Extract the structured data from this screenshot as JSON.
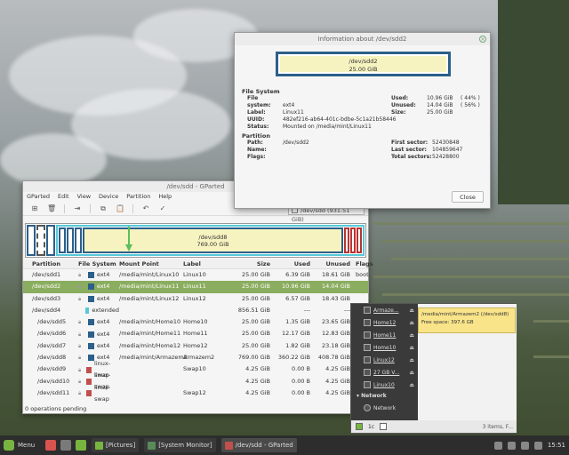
{
  "gparted": {
    "title": "/dev/sdd - GParted",
    "menu": [
      "GParted",
      "Edit",
      "View",
      "Device",
      "Partition",
      "Help"
    ],
    "device_selector": "/dev/sdd  (931.51 GiB)",
    "map_selected_label": "/dev/sdd8",
    "map_selected_size": "769.00 GiB",
    "columns": [
      "Partition",
      "File System",
      "Mount Point",
      "Label",
      "Size",
      "Used",
      "Unused",
      "Flags"
    ],
    "rows": [
      {
        "partition": "/dev/sdd1",
        "fs": "ext4",
        "fs_color": "#2c5f8a",
        "mount": "/media/mint/Linux10",
        "label": "Linux10",
        "size": "25.00 GiB",
        "used": "6.39 GiB",
        "unused": "18.61 GiB",
        "flags": "boot",
        "lock": true
      },
      {
        "partition": "/dev/sdd2",
        "fs": "ext4",
        "fs_color": "#2c5f8a",
        "mount": "/media/mint/Linux11",
        "label": "Linux11",
        "size": "25.00 GiB",
        "used": "10.96 GiB",
        "unused": "14.04 GiB",
        "flags": "",
        "lock": true,
        "selected": true
      },
      {
        "partition": "/dev/sdd3",
        "fs": "ext4",
        "fs_color": "#2c5f8a",
        "mount": "/media/mint/Linux12",
        "label": "Linux12",
        "size": "25.00 GiB",
        "used": "6.57 GiB",
        "unused": "18.43 GiB",
        "flags": "",
        "lock": true
      },
      {
        "partition": "/dev/sdd4",
        "fs": "extended",
        "fs_color": "#55c9d8",
        "mount": "",
        "label": "",
        "size": "856.51 GiB",
        "used": "---",
        "unused": "---",
        "flags": "",
        "lock": false
      },
      {
        "partition": "/dev/sdd5",
        "fs": "ext4",
        "fs_color": "#2c5f8a",
        "mount": "/media/mint/Home10",
        "label": "Home10",
        "size": "25.00 GiB",
        "used": "1.35 GiB",
        "unused": "23.65 GiB",
        "flags": "",
        "lock": true
      },
      {
        "partition": "/dev/sdd6",
        "fs": "ext4",
        "fs_color": "#2c5f8a",
        "mount": "/media/mint/Home11",
        "label": "Home11",
        "size": "25.00 GiB",
        "used": "12.17 GiB",
        "unused": "12.83 GiB",
        "flags": "",
        "lock": true
      },
      {
        "partition": "/dev/sdd7",
        "fs": "ext4",
        "fs_color": "#2c5f8a",
        "mount": "/media/mint/Home12",
        "label": "Home12",
        "size": "25.00 GiB",
        "used": "1.82 GiB",
        "unused": "23.18 GiB",
        "flags": "",
        "lock": true
      },
      {
        "partition": "/dev/sdd8",
        "fs": "ext4",
        "fs_color": "#2c5f8a",
        "mount": "/media/mint/Armazem2",
        "label": "Armazem2",
        "size": "769.00 GiB",
        "used": "360.22 GiB",
        "unused": "408.78 GiB",
        "flags": "",
        "lock": true
      },
      {
        "partition": "/dev/sdd9",
        "fs": "linux-swap",
        "fs_color": "#c0504d",
        "mount": "",
        "label": "Swap10",
        "size": "4.25 GiB",
        "used": "0.00 B",
        "unused": "4.25 GiB",
        "flags": "",
        "lock": true
      },
      {
        "partition": "/dev/sdd10",
        "fs": "linux-swap",
        "fs_color": "#c0504d",
        "mount": "",
        "label": "",
        "size": "4.25 GiB",
        "used": "0.00 B",
        "unused": "4.25 GiB",
        "flags": "",
        "lock": true
      },
      {
        "partition": "/dev/sdd11",
        "fs": "linux-swap",
        "fs_color": "#c0504d",
        "mount": "",
        "label": "Swap12",
        "size": "4.25 GiB",
        "used": "0.00 B",
        "unused": "4.25 GiB",
        "flags": "",
        "lock": true
      }
    ],
    "status": "0 operations pending"
  },
  "info": {
    "title": "Information about /dev/sdd2",
    "map_label": "/dev/sdd2",
    "map_size": "25.00 GiB",
    "fs_section": "File System",
    "fs_keys": [
      "File system:",
      "Label:",
      "UUID:",
      "Status:"
    ],
    "fs_values": [
      "ext4",
      "Linux11",
      "482ef216-ab64-401c-bdbe-5c1a21b58446",
      "Mounted on /media/mint/Linux11"
    ],
    "usage_keys": [
      "Used:",
      "Unused:",
      "Size:"
    ],
    "usage_values": [
      "10.96 GiB",
      "14.04 GiB",
      "25.00 GiB"
    ],
    "usage_pct": [
      "( 44% )",
      "( 56% )"
    ],
    "part_section": "Partition",
    "part_keys": [
      "Path:",
      "Name:",
      "Flags:"
    ],
    "part_values": [
      "/dev/sdd2",
      "",
      ""
    ],
    "sector_keys": [
      "First sector:",
      "Last sector:",
      "Total sectors:"
    ],
    "sector_values": [
      "52430848",
      "104859647",
      "52428800"
    ],
    "close": "Close"
  },
  "filemanager": {
    "items": [
      "Armaze...",
      "Home12",
      "Home11",
      "Home10",
      "Linux12",
      "27 GB V...",
      "Linux10"
    ],
    "network_header": "Network",
    "network_item": "Network",
    "tooltip_line1": "/media/mint/Armazem2 (/dev/sdd8)",
    "tooltip_line2": "Free space: 397.6 GB",
    "view_mode": "1c",
    "count": "3 items, F..."
  },
  "taskbar": {
    "menu": "Menu",
    "tasks": [
      "[Pictures]",
      "[System Monitor]",
      "/dev/sdd - GParted"
    ],
    "clock": "15:51"
  }
}
